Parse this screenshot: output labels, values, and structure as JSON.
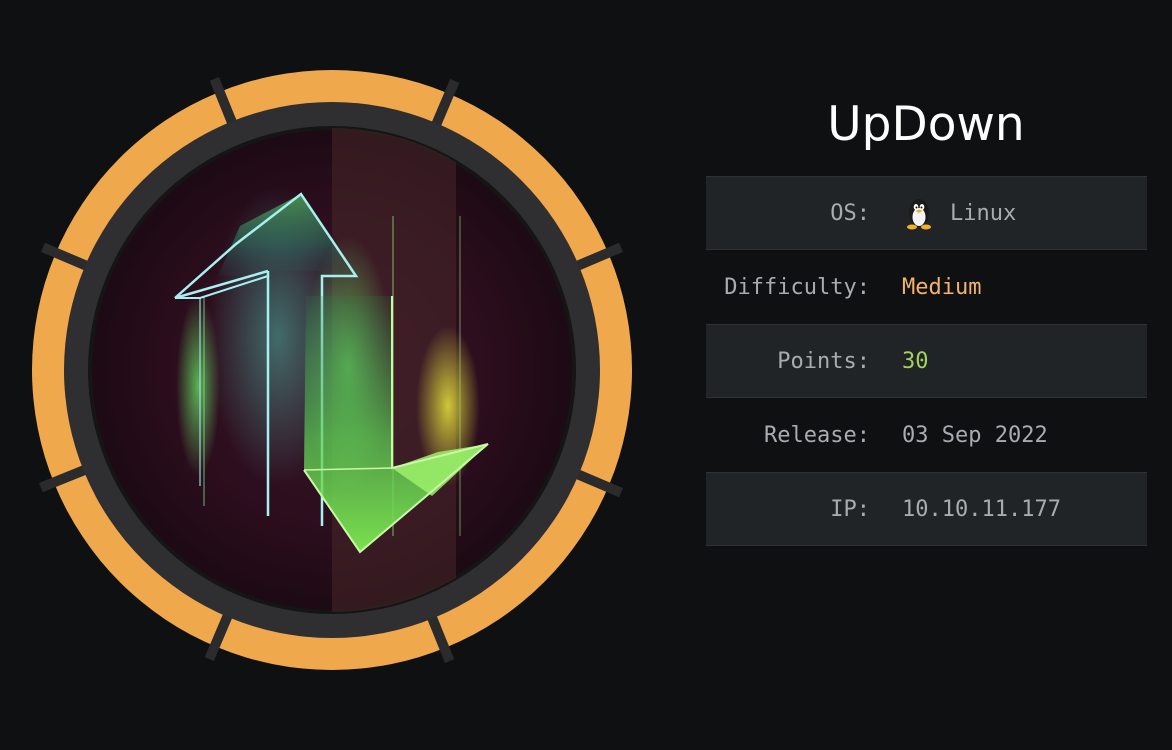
{
  "machine": {
    "name": "UpDown"
  },
  "info": {
    "os_label": "OS:",
    "os_value": "Linux",
    "os_icon": "linux-penguin-icon",
    "difficulty_label": "Difficulty:",
    "difficulty_value": "Medium",
    "points_label": "Points:",
    "points_value": "30",
    "release_label": "Release:",
    "release_value": "03 Sep 2022",
    "ip_label": "IP:",
    "ip_value": "10.10.11.177"
  },
  "colors": {
    "background": "#0f1012",
    "ring": "#f0a84c",
    "difficulty_medium": "#f4b36b",
    "points": "#a5d15a",
    "label": "#a7acb1"
  }
}
